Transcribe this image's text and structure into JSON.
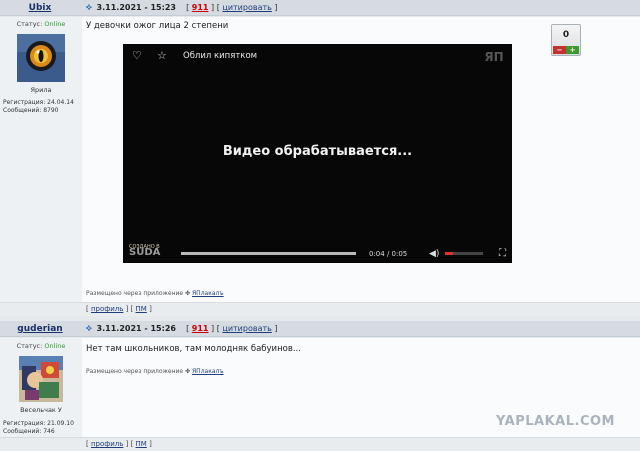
{
  "posts": [
    {
      "nick": "Ubix",
      "date": "3.11.2021 - 15:23",
      "rating_num": "911",
      "quote_label": "цитировать",
      "status_label": "Статус:",
      "status_value": "Online",
      "rank": "Ярила",
      "registration": "Регистрация: 24.04.14",
      "messages": "Сообщений: 8790",
      "text": "У девочки ожог лица 2 степени",
      "posted_via": "Размещено через приложение",
      "app_link": "ЯПлакалъ",
      "profile_link": "профиль",
      "pm_link": "ПМ",
      "score": "0",
      "minus": "−",
      "plus": "+"
    },
    {
      "nick": "guderian",
      "date": "3.11.2021 - 15:26",
      "rating_num": "911",
      "quote_label": "цитировать",
      "status_label": "Статус:",
      "status_value": "Online",
      "rank": "Весельчак У",
      "registration": "Регистрация: 21.09.10",
      "messages": "Сообщений: 746",
      "text": "Нет там школьников, там молодняк бабуинов...",
      "posted_via": "Размещено через приложение",
      "app_link": "ЯПлакалъ",
      "profile_link": "профиль",
      "pm_link": "ПМ"
    }
  ],
  "video": {
    "title": "Облил кипятком",
    "status": "Видео обрабатывается...",
    "brand_top": "СОЗДАНО В",
    "brand_name": "SUDA",
    "time": "0:04  /  0:05",
    "progress": 1.0,
    "volume": 0.2,
    "logo": "ЯП",
    "icons": [
      "heart-icon",
      "star-icon",
      "volume-icon",
      "fullscreen-icon"
    ]
  },
  "watermark": "YAPLAKAL.COM",
  "colors": {
    "online": "#2c9a2c",
    "rating_num": "#c00000",
    "minus": "#c43131",
    "plus": "#3b9a2b"
  }
}
